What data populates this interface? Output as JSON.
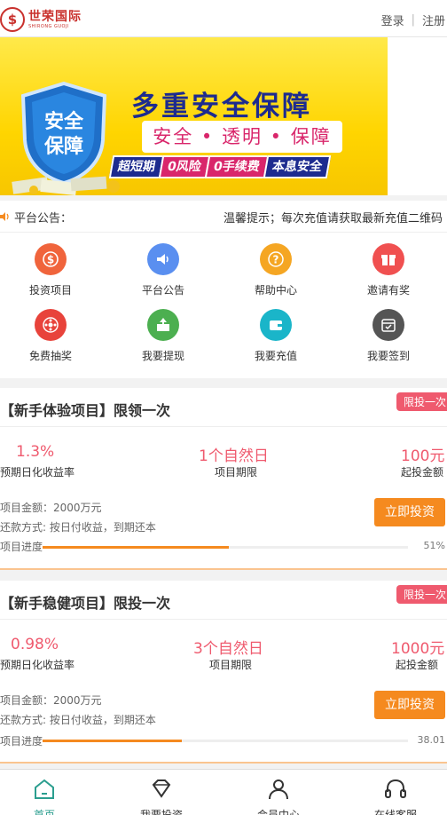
{
  "header": {
    "logo_text": "世荣国际",
    "logo_sub": "SHIRONG GUOJI",
    "login": "登录",
    "separator": "|",
    "register": "注册"
  },
  "banner": {
    "shield_line1": "安全",
    "shield_line2": "保障",
    "title": "多重安全保障",
    "subtitle": "安全 • 透明 • 保障",
    "tags": [
      "超短期",
      "0风险",
      "0手续费",
      "本息安全"
    ]
  },
  "notice": {
    "label": "平台公告：",
    "text": "温馨提示；每次充值请获取最新充值二维码"
  },
  "grid": [
    {
      "label": "投资项目",
      "color": "#f0643c",
      "icon": "dollar-icon"
    },
    {
      "label": "平台公告",
      "color": "#5a8ff0",
      "icon": "megaphone-icon"
    },
    {
      "label": "帮助中心",
      "color": "#f5a623",
      "icon": "question-icon"
    },
    {
      "label": "邀请有奖",
      "color": "#f05050",
      "icon": "gift-icon"
    },
    {
      "label": "免费抽奖",
      "color": "#e8433b",
      "icon": "lottery-wheel-icon"
    },
    {
      "label": "我要提现",
      "color": "#4caf50",
      "icon": "withdraw-icon"
    },
    {
      "label": "我要充值",
      "color": "#1ab5c9",
      "icon": "wallet-icon"
    },
    {
      "label": "我要签到",
      "color": "#555555",
      "icon": "calendar-check-icon"
    }
  ],
  "projects": [
    {
      "title": "【新手体验项目】限领一次",
      "badge": "限投一次",
      "rate": "1.3%",
      "rate_label": "预期日化收益率",
      "term": "1个自然日",
      "term_label": "项目期限",
      "min": "100元",
      "min_label": "起投金额",
      "amount": "项目金额：2000万元",
      "repay": "还款方式: 按日付收益，到期还本",
      "button": "立即投资",
      "progress_label": "项目进度",
      "progress_text": "51%",
      "progress": 0.51
    },
    {
      "title": "【新手稳健项目】限投一次",
      "badge": "限投一次",
      "rate": "0.98%",
      "rate_label": "预期日化收益率",
      "term": "3个自然日",
      "term_label": "项目期限",
      "min": "1000元",
      "min_label": "起投金额",
      "amount": "项目金额：2000万元",
      "repay": "还款方式: 按日付收益，到期还本",
      "button": "立即投资",
      "progress_label": "项目进度",
      "progress_text": "38.01",
      "progress": 0.3801
    }
  ],
  "tabbar": [
    {
      "label": "首页",
      "icon": "home-icon",
      "active": true
    },
    {
      "label": "我要投资",
      "icon": "diamond-icon",
      "active": false
    },
    {
      "label": "会员中心",
      "icon": "user-icon",
      "active": false
    },
    {
      "label": "在线客服",
      "icon": "headset-icon",
      "active": false
    }
  ],
  "colors": {
    "accent": "#f58a1f",
    "rate_red": "#ef5a6e",
    "active_tab": "#2b9e8f",
    "brand_red": "#c9302c"
  }
}
